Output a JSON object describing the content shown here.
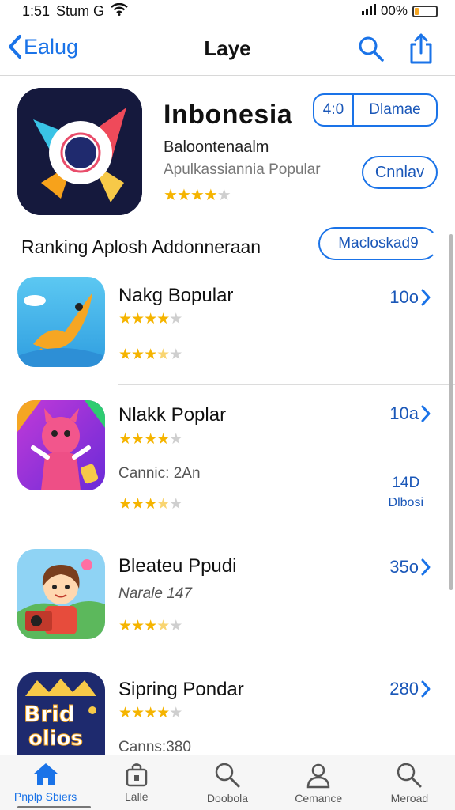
{
  "status": {
    "time": "1:51",
    "carrier": "Stum G",
    "battery_percent": "00%",
    "battery_level": 0.2
  },
  "nav": {
    "back_label": "Ealug",
    "title": "Laye"
  },
  "hero": {
    "title": "Inbonesia",
    "subtitle": "Baloontenaalm",
    "category": "Apulkassiannia Popular",
    "rating": 4,
    "segment_left": "4:0",
    "segment_right": "Dlamae",
    "action_label": "Cnnlav"
  },
  "section": {
    "title": "Ranking Aplosh Addonneraan",
    "pill_label": "Macloskad9"
  },
  "apps": [
    {
      "name": "Nakg Bopular",
      "rating": 4,
      "rating2": 3.5,
      "meta": "",
      "value": "10o",
      "sub1": "",
      "sub2": ""
    },
    {
      "name": "Nlakk Poplar",
      "rating": 4,
      "rating2": 3.5,
      "meta": "Cannic: 2An",
      "value": "10a",
      "sub1": "14D",
      "sub2": "Dlbosi"
    },
    {
      "name": "Bleateu Ppudi",
      "rating": 3.5,
      "rating2": null,
      "meta": "Narale 147",
      "value": "35o",
      "sub1": "",
      "sub2": ""
    },
    {
      "name": "Sipring Pondar",
      "rating": 4,
      "rating2": null,
      "meta": "Canns:380",
      "value": "280",
      "sub1": "",
      "sub2": ""
    }
  ],
  "tabs": [
    {
      "label": "Pnplp Sbiers",
      "icon": "home-icon",
      "active": true
    },
    {
      "label": "Lalle",
      "icon": "lock-bag-icon",
      "active": false
    },
    {
      "label": "Doobola",
      "icon": "search-icon",
      "active": false
    },
    {
      "label": "Cemance",
      "icon": "person-icon",
      "active": false
    },
    {
      "label": "Meroad",
      "icon": "search-icon",
      "active": false
    }
  ],
  "colors": {
    "accent": "#1a73e8",
    "star": "#f5b400",
    "star_off": "#cfcfcf"
  }
}
